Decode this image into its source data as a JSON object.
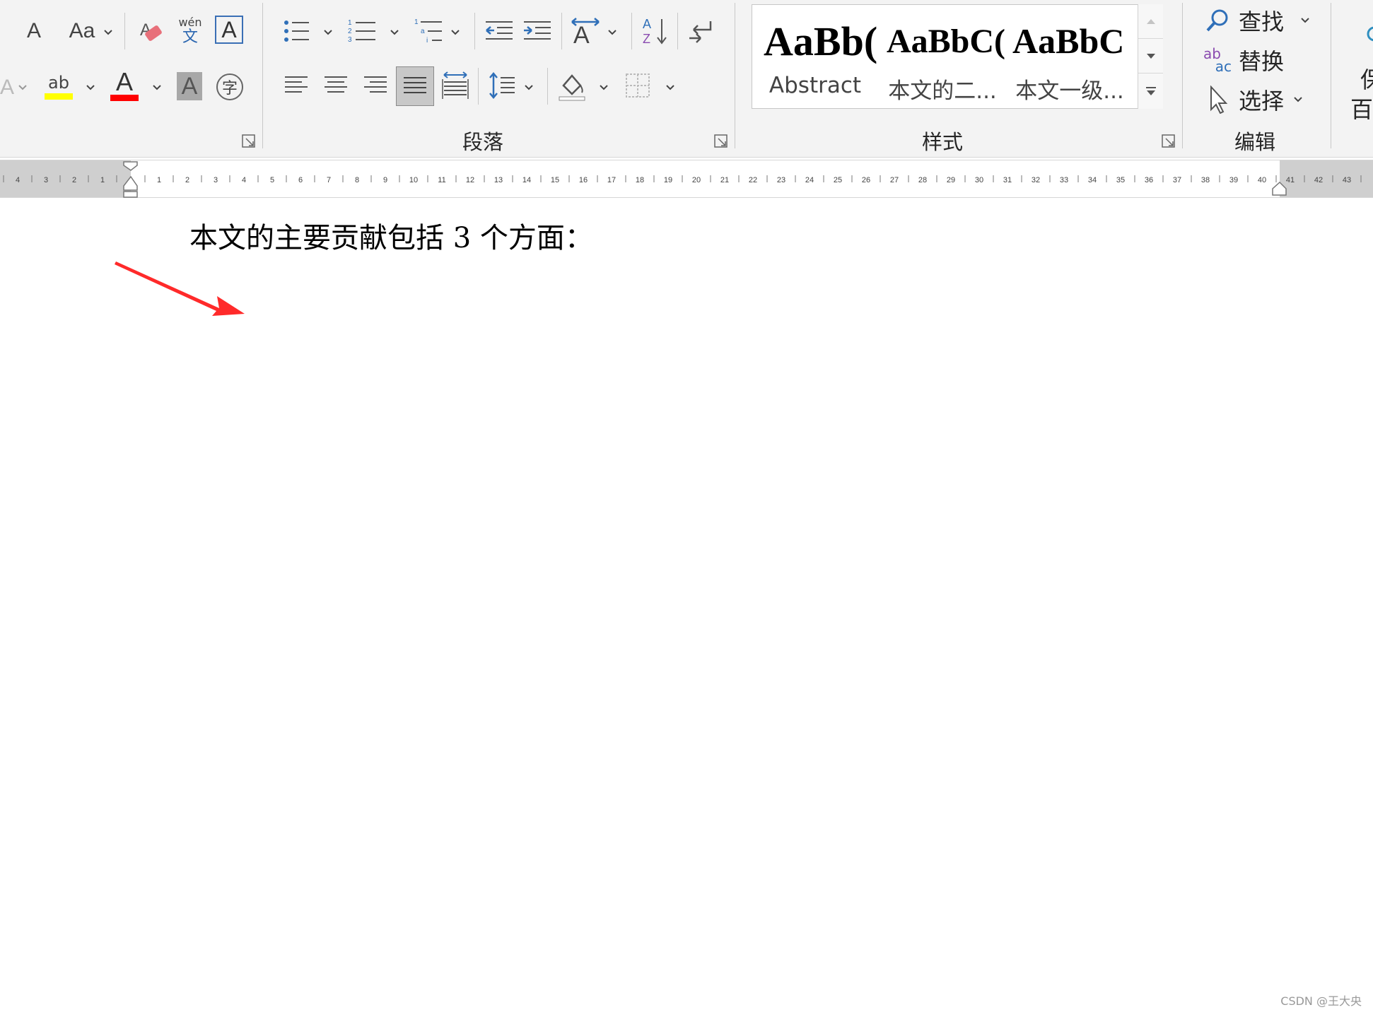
{
  "ribbon": {
    "font": {
      "shrink_glyph": "A",
      "change_case_label": "Aa",
      "phonetic_top": "wén",
      "phonetic_bottom": "文",
      "char_border_glyph": "A",
      "highlight_glyph": "ab",
      "font_color_glyph": "A",
      "char_shading_glyph": "A",
      "enclose_char_glyph": "字",
      "highlight_color": "#ffff00",
      "font_color": "#ff0000"
    },
    "paragraph": {
      "group_label": "段落",
      "multilevel_glyph": "1 a i"
    },
    "styles": {
      "group_label": "样式",
      "items": [
        {
          "sample": "AaBb(",
          "name": "Abstract"
        },
        {
          "sample": "AaBbC(",
          "name": "本文的二..."
        },
        {
          "sample": "AaBbC",
          "name": "本文一级..."
        }
      ]
    },
    "editing": {
      "group_label": "编辑",
      "find_label": "查找",
      "replace_label": "替换",
      "select_label": "选择",
      "replace_icon_top": "ab",
      "replace_icon_bottom": "ac"
    },
    "partial_right_top": "保",
    "partial_right_bottom": "百"
  },
  "ruler": {
    "left_numbers": [
      "4",
      "3",
      "2",
      "1"
    ],
    "main_numbers": [
      "1",
      "2",
      "3",
      "4",
      "5",
      "6",
      "7",
      "8",
      "9",
      "10",
      "11",
      "12",
      "13",
      "14",
      "15",
      "16",
      "17",
      "18",
      "19",
      "20",
      "21",
      "22",
      "23",
      "24",
      "25",
      "26",
      "27",
      "28",
      "29",
      "30",
      "31",
      "32",
      "33",
      "34",
      "35",
      "36",
      "37",
      "38",
      "39",
      "40"
    ],
    "right_numbers": [
      "41",
      "42",
      "43"
    ]
  },
  "document": {
    "line": "本文的主要贡献包括 3 个方面："
  },
  "annotation": {
    "arrow_color": "#ff2a2a"
  },
  "watermark": "CSDN @王大央"
}
